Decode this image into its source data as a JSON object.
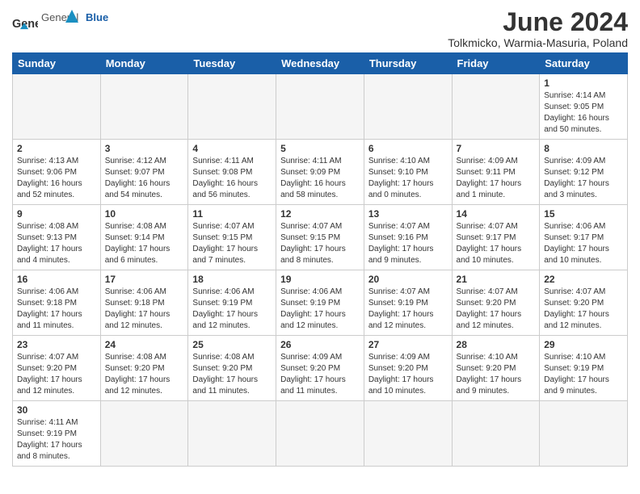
{
  "header": {
    "logo_general": "General",
    "logo_blue": "Blue",
    "main_title": "June 2024",
    "subtitle": "Tolkmicko, Warmia-Masuria, Poland"
  },
  "days_of_week": [
    "Sunday",
    "Monday",
    "Tuesday",
    "Wednesday",
    "Thursday",
    "Friday",
    "Saturday"
  ],
  "weeks": [
    [
      {
        "day": "",
        "info": ""
      },
      {
        "day": "",
        "info": ""
      },
      {
        "day": "",
        "info": ""
      },
      {
        "day": "",
        "info": ""
      },
      {
        "day": "",
        "info": ""
      },
      {
        "day": "",
        "info": ""
      },
      {
        "day": "1",
        "info": "Sunrise: 4:14 AM\nSunset: 9:05 PM\nDaylight: 16 hours and 50 minutes."
      }
    ],
    [
      {
        "day": "2",
        "info": "Sunrise: 4:13 AM\nSunset: 9:06 PM\nDaylight: 16 hours and 52 minutes."
      },
      {
        "day": "3",
        "info": "Sunrise: 4:12 AM\nSunset: 9:07 PM\nDaylight: 16 hours and 54 minutes."
      },
      {
        "day": "4",
        "info": "Sunrise: 4:11 AM\nSunset: 9:08 PM\nDaylight: 16 hours and 56 minutes."
      },
      {
        "day": "5",
        "info": "Sunrise: 4:11 AM\nSunset: 9:09 PM\nDaylight: 16 hours and 58 minutes."
      },
      {
        "day": "6",
        "info": "Sunrise: 4:10 AM\nSunset: 9:10 PM\nDaylight: 17 hours and 0 minutes."
      },
      {
        "day": "7",
        "info": "Sunrise: 4:09 AM\nSunset: 9:11 PM\nDaylight: 17 hours and 1 minute."
      },
      {
        "day": "8",
        "info": "Sunrise: 4:09 AM\nSunset: 9:12 PM\nDaylight: 17 hours and 3 minutes."
      }
    ],
    [
      {
        "day": "9",
        "info": "Sunrise: 4:08 AM\nSunset: 9:13 PM\nDaylight: 17 hours and 4 minutes."
      },
      {
        "day": "10",
        "info": "Sunrise: 4:08 AM\nSunset: 9:14 PM\nDaylight: 17 hours and 6 minutes."
      },
      {
        "day": "11",
        "info": "Sunrise: 4:07 AM\nSunset: 9:15 PM\nDaylight: 17 hours and 7 minutes."
      },
      {
        "day": "12",
        "info": "Sunrise: 4:07 AM\nSunset: 9:15 PM\nDaylight: 17 hours and 8 minutes."
      },
      {
        "day": "13",
        "info": "Sunrise: 4:07 AM\nSunset: 9:16 PM\nDaylight: 17 hours and 9 minutes."
      },
      {
        "day": "14",
        "info": "Sunrise: 4:07 AM\nSunset: 9:17 PM\nDaylight: 17 hours and 10 minutes."
      },
      {
        "day": "15",
        "info": "Sunrise: 4:06 AM\nSunset: 9:17 PM\nDaylight: 17 hours and 10 minutes."
      }
    ],
    [
      {
        "day": "16",
        "info": "Sunrise: 4:06 AM\nSunset: 9:18 PM\nDaylight: 17 hours and 11 minutes."
      },
      {
        "day": "17",
        "info": "Sunrise: 4:06 AM\nSunset: 9:18 PM\nDaylight: 17 hours and 12 minutes."
      },
      {
        "day": "18",
        "info": "Sunrise: 4:06 AM\nSunset: 9:19 PM\nDaylight: 17 hours and 12 minutes."
      },
      {
        "day": "19",
        "info": "Sunrise: 4:06 AM\nSunset: 9:19 PM\nDaylight: 17 hours and 12 minutes."
      },
      {
        "day": "20",
        "info": "Sunrise: 4:07 AM\nSunset: 9:19 PM\nDaylight: 17 hours and 12 minutes."
      },
      {
        "day": "21",
        "info": "Sunrise: 4:07 AM\nSunset: 9:20 PM\nDaylight: 17 hours and 12 minutes."
      },
      {
        "day": "22",
        "info": "Sunrise: 4:07 AM\nSunset: 9:20 PM\nDaylight: 17 hours and 12 minutes."
      }
    ],
    [
      {
        "day": "23",
        "info": "Sunrise: 4:07 AM\nSunset: 9:20 PM\nDaylight: 17 hours and 12 minutes."
      },
      {
        "day": "24",
        "info": "Sunrise: 4:08 AM\nSunset: 9:20 PM\nDaylight: 17 hours and 12 minutes."
      },
      {
        "day": "25",
        "info": "Sunrise: 4:08 AM\nSunset: 9:20 PM\nDaylight: 17 hours and 11 minutes."
      },
      {
        "day": "26",
        "info": "Sunrise: 4:09 AM\nSunset: 9:20 PM\nDaylight: 17 hours and 11 minutes."
      },
      {
        "day": "27",
        "info": "Sunrise: 4:09 AM\nSunset: 9:20 PM\nDaylight: 17 hours and 10 minutes."
      },
      {
        "day": "28",
        "info": "Sunrise: 4:10 AM\nSunset: 9:20 PM\nDaylight: 17 hours and 9 minutes."
      },
      {
        "day": "29",
        "info": "Sunrise: 4:10 AM\nSunset: 9:19 PM\nDaylight: 17 hours and 9 minutes."
      }
    ],
    [
      {
        "day": "30",
        "info": "Sunrise: 4:11 AM\nSunset: 9:19 PM\nDaylight: 17 hours and 8 minutes."
      },
      {
        "day": "",
        "info": ""
      },
      {
        "day": "",
        "info": ""
      },
      {
        "day": "",
        "info": ""
      },
      {
        "day": "",
        "info": ""
      },
      {
        "day": "",
        "info": ""
      },
      {
        "day": "",
        "info": ""
      }
    ]
  ]
}
